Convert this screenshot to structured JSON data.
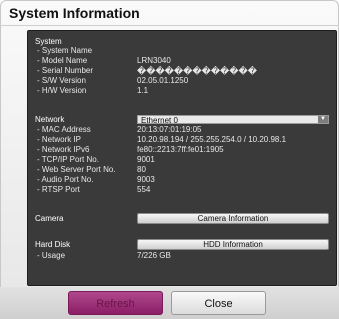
{
  "dialog": {
    "title": "System Information"
  },
  "system": {
    "heading": "System",
    "system_name_label": "- System Name",
    "system_name_value": "",
    "model_name_label": "- Model Name",
    "model_name_value": "LRN3040",
    "serial_number_label": "- Serial Number",
    "serial_number_value": "�������������",
    "sw_version_label": "- S/W Version",
    "sw_version_value": "02.05.01.1250",
    "hw_version_label": "- H/W Version",
    "hw_version_value": "1.1"
  },
  "network": {
    "heading": "Network",
    "selected_interface": "Ethernet 0",
    "mac_label": "- MAC Address",
    "mac_value": "20:13:07:01:19:05",
    "ip_label": "- Network IP",
    "ip_value": "10.20.98.194 / 255.255.254.0 / 10.20.98.1",
    "ipv6_label": "- Network IPv6",
    "ipv6_value": "fe80::2213:7ff:fe01:1905",
    "tcp_label": "- TCP/IP Port No.",
    "tcp_value": "9001",
    "web_label": "- Web Server Port No.",
    "web_value": "80",
    "audio_label": "- Audio Port No.",
    "audio_value": "9003",
    "rtsp_label": "- RTSP Port",
    "rtsp_value": "554"
  },
  "camera": {
    "heading": "Camera",
    "button_label": "Camera Information"
  },
  "hdd": {
    "heading": "Hard Disk",
    "button_label": "HDD Information",
    "usage_label": "- Usage",
    "usage_value": "7/226 GB"
  },
  "footer": {
    "refresh_label": "Refresh",
    "close_label": "Close"
  },
  "colors": {
    "panel_bg": "#3a3a3a",
    "refresh_accent": "#8b1e66"
  }
}
